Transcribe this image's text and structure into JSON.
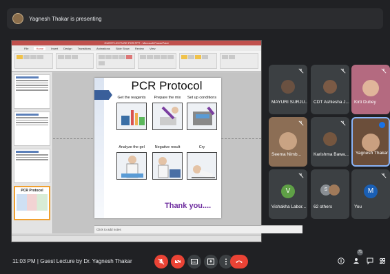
{
  "presenter": {
    "text": "Yagnesh Thakar is presenting"
  },
  "ppt": {
    "window_title": "GUEST LECTURE PCR PPT - Microsoft PowerPoint",
    "tabs": [
      "File",
      "Home",
      "Insert",
      "Design",
      "Transitions",
      "Animations",
      "Slide Show",
      "Review",
      "View"
    ],
    "notes_placeholder": "Click to add notes",
    "thumb_title": "PCR Protocol"
  },
  "slide": {
    "title": "PCR Protocol",
    "steps": [
      "Get the reagents",
      "Prepare the mix",
      "Set up conditions",
      "Analyze the gel",
      "Negative result",
      "Cry"
    ],
    "thanks": "Thank you...."
  },
  "participants": [
    {
      "name": "MAYURI SURJU...",
      "type": "photo",
      "color": "#6a5141"
    },
    {
      "name": "CDT Ashlesha J...",
      "type": "photo",
      "color": "#7b5a45"
    },
    {
      "name": "Kirti Dubey",
      "type": "photo",
      "color": "#b46a80"
    },
    {
      "name": "Seema Nimb...",
      "type": "video",
      "color": "#8c6e55"
    },
    {
      "name": "Karishma Bawa...",
      "type": "photo",
      "color": "#75563f"
    },
    {
      "name": "Yagnesh Thakar",
      "type": "video",
      "color": "#6b4e3a"
    },
    {
      "name": "Vishakha Labor...",
      "type": "letter",
      "letter": "V",
      "color": "#5fa046"
    },
    {
      "name": "62 others",
      "type": "others",
      "color": "#8a8f94"
    },
    {
      "name": "You",
      "type": "letter",
      "letter": "M",
      "color": "#1a5fb4"
    }
  ],
  "bottom": {
    "time": "11:03 PM",
    "separator": "|",
    "meeting": "Guest Lecture by Dr. Yagnesh Thakar",
    "people_count": "71"
  }
}
